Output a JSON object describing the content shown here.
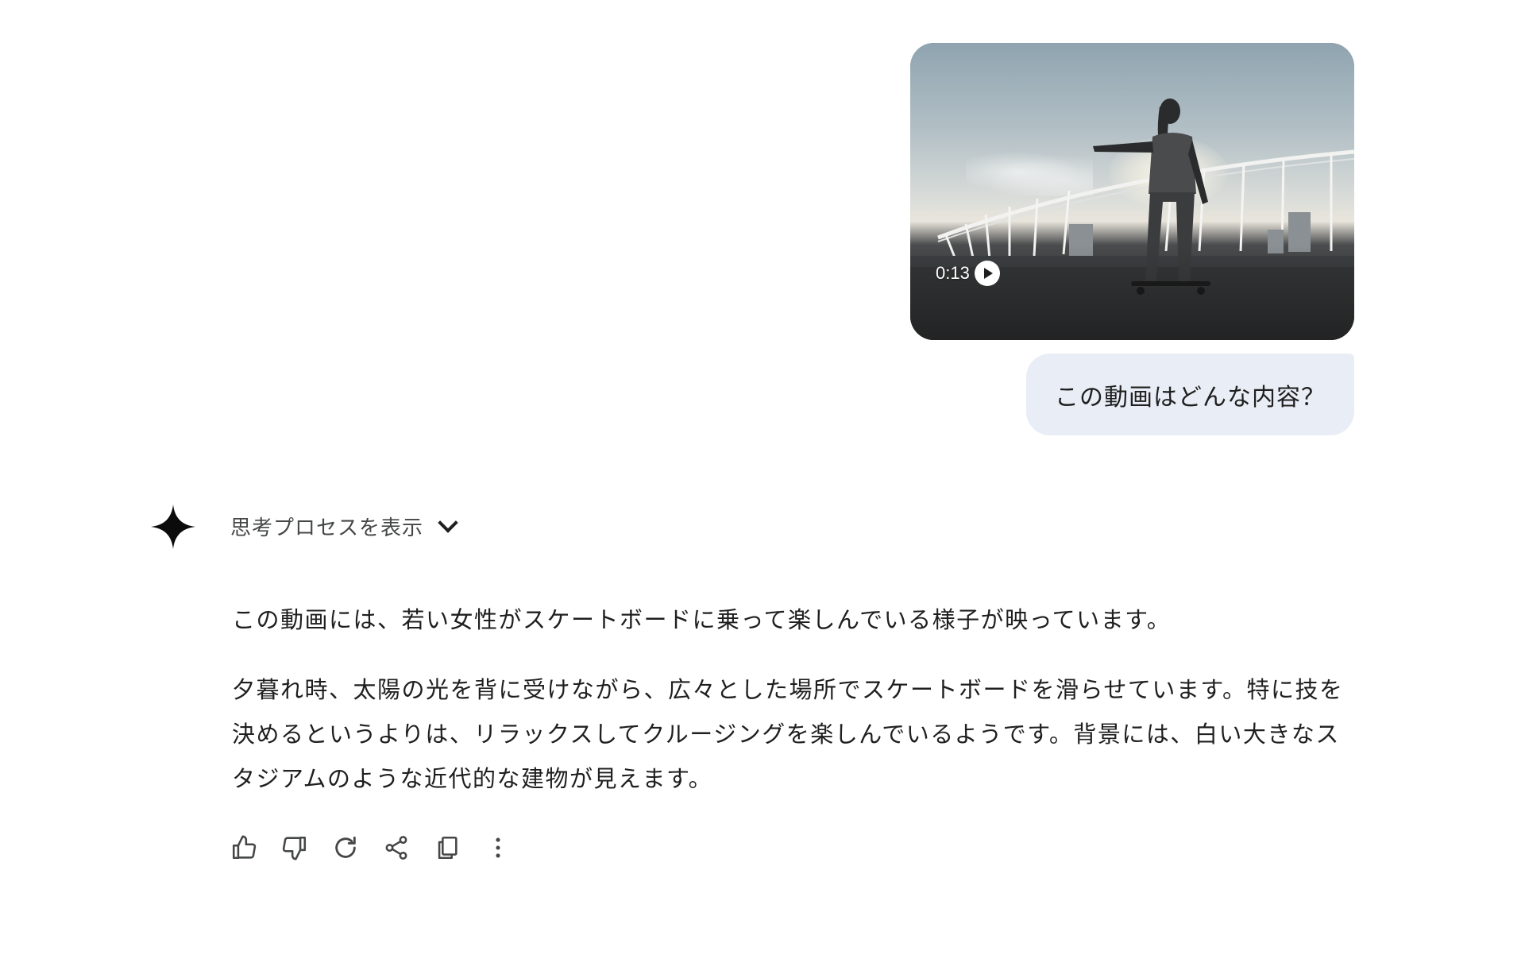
{
  "user_turn": {
    "video": {
      "duration": "0:13",
      "play_icon": "play-icon"
    },
    "message": "この動画はどんな内容？"
  },
  "model_turn": {
    "logo_icon": "gemini-sparkle-icon",
    "thinking": {
      "label": "思考プロセスを表示",
      "icon": "chevron-down-icon"
    },
    "paragraphs": [
      "この動画には、若い女性がスケートボードに乗って楽しんでいる様子が映っています。",
      "夕暮れ時、太陽の光を背に受けながら、広々とした場所でスケートボードを滑らせています。特に技を決めるというよりは、リラックスしてクルージングを楽しんでいるようです。背景には、白い大きなスタジアムのような近代的な建物が見えます。"
    ],
    "actions": [
      {
        "name": "thumbs-up-icon"
      },
      {
        "name": "thumbs-down-icon"
      },
      {
        "name": "regenerate-icon"
      },
      {
        "name": "share-icon"
      },
      {
        "name": "copy-icon"
      },
      {
        "name": "more-vert-icon"
      }
    ]
  },
  "colors": {
    "user_bubble_bg": "#e9eef6",
    "text": "#1f1f1f",
    "secondary_text": "#444746",
    "icon": "#444746"
  }
}
